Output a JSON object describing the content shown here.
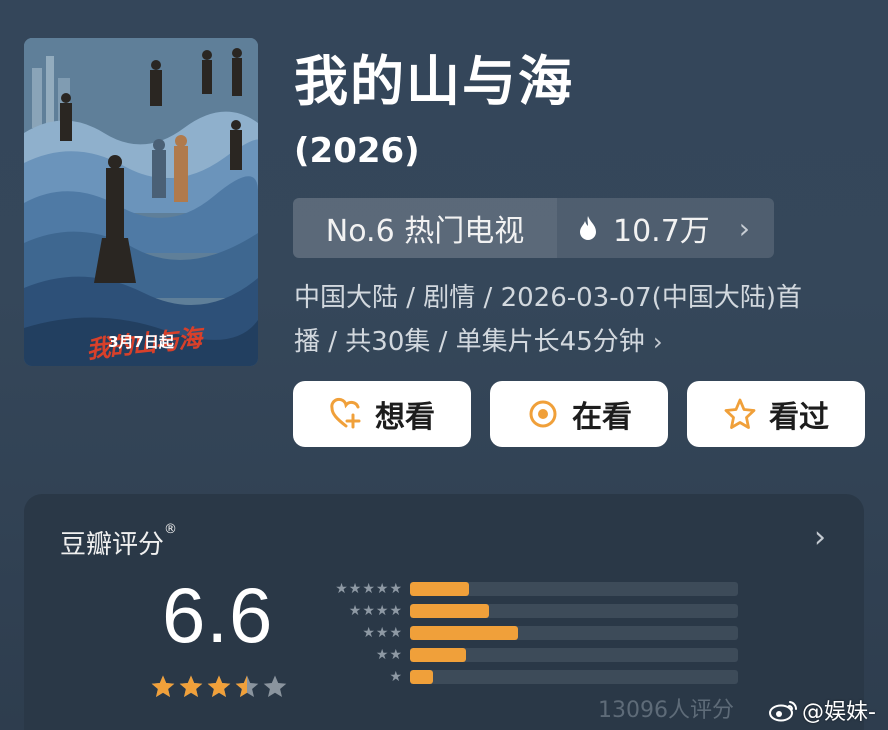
{
  "poster": {
    "date_text": "3月7日起",
    "logo_text": "我的山与海"
  },
  "title": "我的山与海",
  "year": "(2026)",
  "rank": {
    "label": "No.6 热门电视",
    "heat": "10.7万",
    "chevron": "›"
  },
  "meta": {
    "line1": "中国大陆 / 剧情 / 2026-03-07(中国大陆)首",
    "line2": "播 / 共30集 / 单集片长45分钟",
    "chevron": "›"
  },
  "actions": [
    {
      "label": "想看",
      "icon": "heart-plus-icon"
    },
    {
      "label": "在看",
      "icon": "target-circle-icon"
    },
    {
      "label": "看过",
      "icon": "star-outline-icon"
    }
  ],
  "rating": {
    "title": "豆瓣评分",
    "registered_mark": "®",
    "chevron": "›",
    "score": "6.6",
    "stars_value": 3.5,
    "distribution": [
      {
        "stars": 5,
        "fraction": 0.18
      },
      {
        "stars": 4,
        "fraction": 0.24
      },
      {
        "stars": 3,
        "fraction": 0.33
      },
      {
        "stars": 2,
        "fraction": 0.17
      },
      {
        "stars": 1,
        "fraction": 0.07
      }
    ],
    "count_text": "13096人评分"
  },
  "watermark": {
    "text": "@娱妹-"
  },
  "colors": {
    "accent": "#f0a03a",
    "background": "#34465a",
    "card": "#2a3847",
    "button_bg": "#ffffff"
  }
}
